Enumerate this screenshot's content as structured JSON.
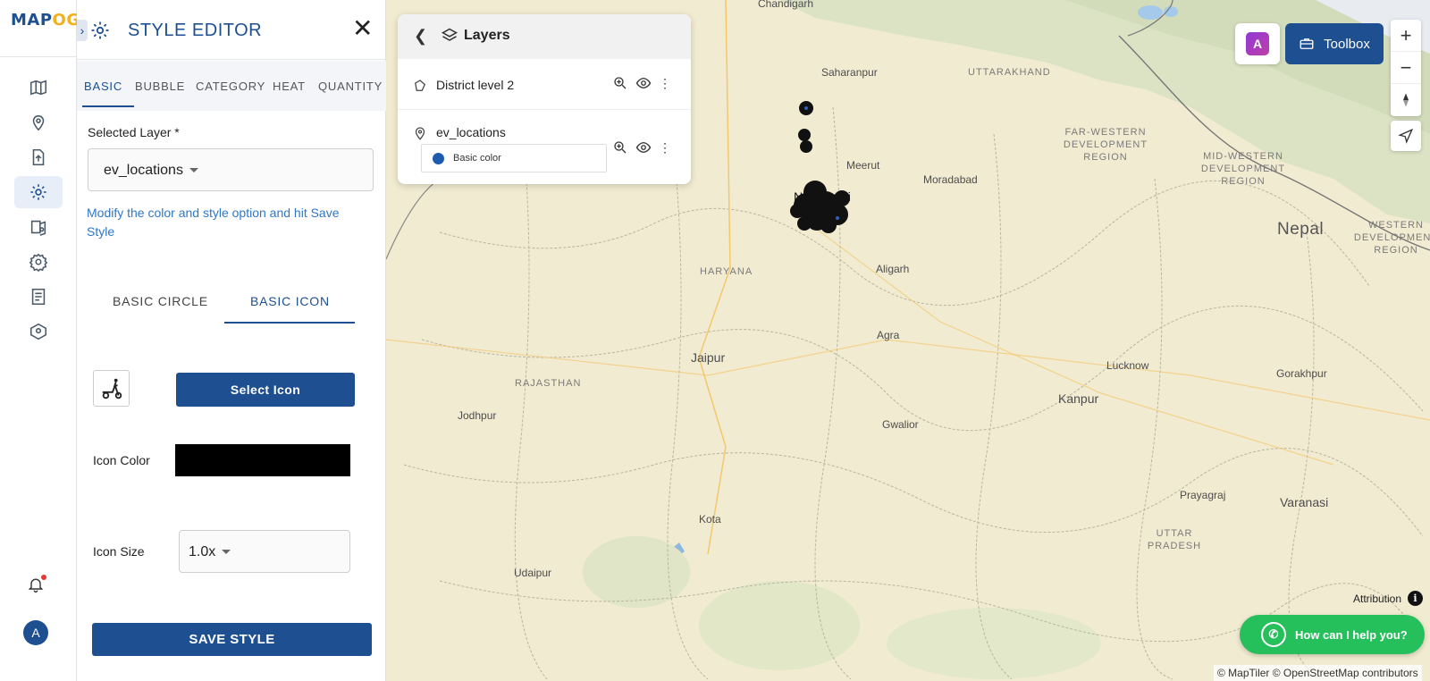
{
  "app": {
    "logo_main": "MAP",
    "logo_accent": "OG"
  },
  "style_editor": {
    "title": "STYLE EDITOR",
    "close": "✕",
    "tabs": [
      "BASIC",
      "BUBBLE",
      "CATEGORY",
      "HEAT",
      "QUANTITY"
    ],
    "active_tab": "BASIC",
    "selected_layer_label": "Selected Layer *",
    "selected_layer_value": "ev_locations",
    "hint": "Modify the color and style option and hit Save Style",
    "sub_tabs": [
      "BASIC CIRCLE",
      "BASIC ICON"
    ],
    "active_sub_tab": "BASIC ICON",
    "select_icon_label": "Select Icon",
    "icon_color_label": "Icon Color",
    "icon_color_value": "#000000",
    "icon_size_label": "Icon Size",
    "icon_size_value": "1.0x",
    "save_label": "SAVE STYLE"
  },
  "rail": {
    "items": [
      "map-icon",
      "location-pin-icon",
      "upload-file-icon",
      "gear-icon",
      "map-settings-icon",
      "settings-icon",
      "report-icon",
      "map-pin-icon"
    ],
    "active_index": 3,
    "avatar_initial": "A"
  },
  "layers_panel": {
    "title": "Layers",
    "layers": [
      {
        "name": "District level 2",
        "icon": "polygon-icon"
      },
      {
        "name": "ev_locations",
        "icon": "location-pin-icon",
        "legend": "Basic color",
        "legend_color": "#1d5ab0"
      }
    ]
  },
  "map_controls": {
    "toolbox_label": "Toolbox",
    "ai_label": "A",
    "zoom_in": "+",
    "zoom_out": "−",
    "attribution_label": "Attribution",
    "whatsapp_label": "How can I help you?",
    "copyright": "© MapTiler © OpenStreetMap contributors"
  },
  "map_labels": {
    "cities": [
      "Chandigarh",
      "Saharanpur",
      "Meerut",
      "Moradabad",
      "New Delhi",
      "Aligarh",
      "Agra",
      "Jaipur",
      "Jodhpur",
      "Gwalior",
      "Lucknow",
      "Kanpur",
      "Gorakhpur",
      "Prayagraj",
      "Varanasi",
      "Kota",
      "Udaipur"
    ],
    "regions": [
      "UTTARAKHAND",
      "HARYANA",
      "RAJASTHAN",
      "UTTAR PRADESH",
      "FAR-WESTERN DEVELOPMENT REGION",
      "MID-WESTERN DEVELOPMENT REGION",
      "WESTERN DEVELOPMENT REGION"
    ],
    "country": "Nepal"
  },
  "colors": {
    "brand": "#1d4f91",
    "accent": "#f2b01e",
    "hint": "#2e78c7",
    "whatsapp": "#25c05b"
  }
}
